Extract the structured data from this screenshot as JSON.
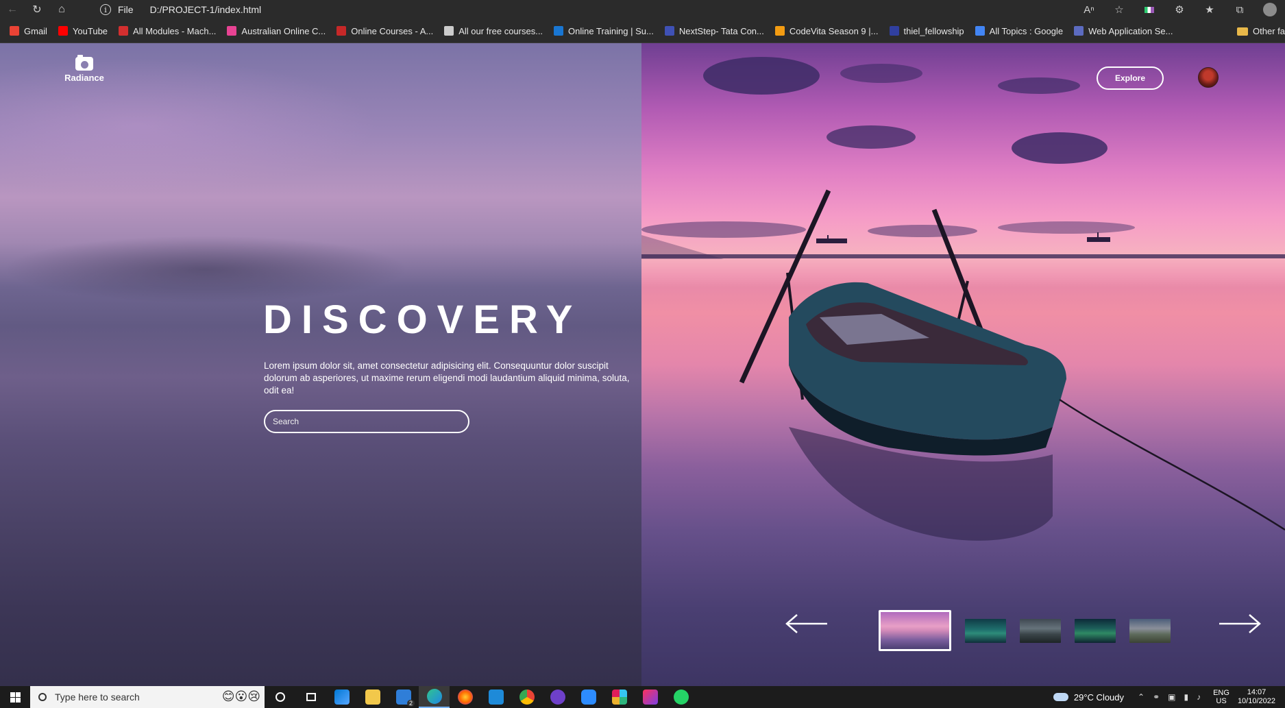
{
  "browser": {
    "nav": {
      "back_icon": "back-arrow-icon",
      "refresh_icon": "refresh-icon",
      "home_icon": "home-icon"
    },
    "address": {
      "scheme_label": "File",
      "url": "D:/PROJECT-1/index.html"
    },
    "toolbar_icons": [
      "read-aloud-icon",
      "favorite-star-icon",
      "extension-badge-icon",
      "extensions-icon",
      "favorites-icon",
      "collections-icon",
      "profile-icon"
    ],
    "bookmarks": [
      {
        "label": "Gmail",
        "color": "#ea4335"
      },
      {
        "label": "YouTube",
        "color": "#ff0000"
      },
      {
        "label": "All Modules - Mach...",
        "color": "#d32f2f"
      },
      {
        "label": "Australian Online C...",
        "color": "#e84393"
      },
      {
        "label": "Online Courses - A...",
        "color": "#c62828"
      },
      {
        "label": "All our free courses...",
        "color": "#cccccc"
      },
      {
        "label": "Online Training | Su...",
        "color": "#1976d2"
      },
      {
        "label": "NextStep- Tata Con...",
        "color": "#3f51b5"
      },
      {
        "label": "CodeVita Season 9 |...",
        "color": "#f39c12"
      },
      {
        "label": "thiel_fellowship",
        "color": "#303f9f"
      },
      {
        "label": "All Topics : Google",
        "color": "#4285f4"
      },
      {
        "label": "Web Application Se...",
        "color": "#5c6bc0"
      }
    ],
    "other_favorites": "Other fa"
  },
  "site": {
    "logo_text": "Radiance",
    "explore_label": "Explore",
    "hero_title": "DISCOVERY",
    "hero_text": "Lorem ipsum dolor sit, amet consectetur adipisicing elit. Consequuntur dolor suscipit dolorum ab asperiores, ut maxime rerum eligendi modi laudantium aliquid minima, soluta, odit ea!",
    "search_placeholder": "Search",
    "thumbnails": [
      "sunset-boat",
      "aurora-1",
      "cloudy-lake",
      "aurora-2",
      "mountain-valley"
    ],
    "active_thumbnail": 0
  },
  "taskbar": {
    "search_placeholder": "Type here to search",
    "search_emoji": "😊😮😢",
    "apps": [
      "cortana-icon",
      "task-view-icon",
      "store-icon",
      "file-explorer-icon",
      "mail-icon",
      "edge-icon",
      "firefox-icon",
      "vscode-icon",
      "chrome-icon",
      "github-icon",
      "zoom-icon",
      "slack-icon",
      "intellij-icon",
      "whatsapp-icon"
    ],
    "mail_badge": "2",
    "weather": "29°C  Cloudy",
    "language": "ENG",
    "region": "US",
    "time": "14:07",
    "date": "10/10/2022"
  }
}
